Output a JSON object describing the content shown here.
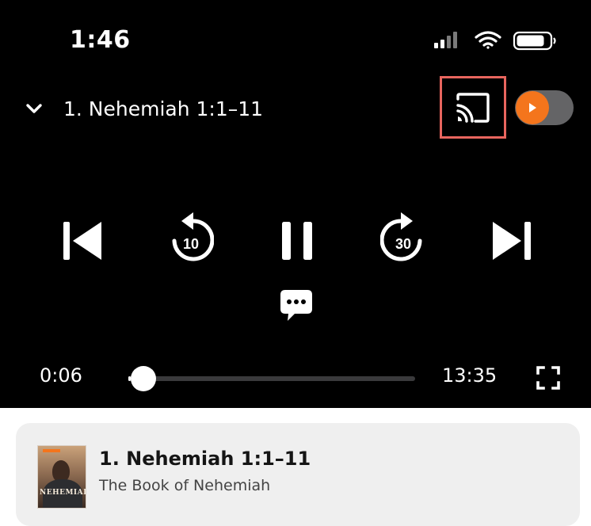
{
  "status_bar": {
    "time": "1:46",
    "signal_icon": "cellular-signal-icon",
    "wifi_icon": "wifi-icon",
    "battery_icon": "battery-icon"
  },
  "header": {
    "collapse_icon": "chevron-down-icon",
    "title": "1. Nehemiah 1:1–11",
    "cast_icon": "cast-icon",
    "autoplay_toggle_on": false
  },
  "controls": {
    "previous_icon": "skip-previous-icon",
    "rewind_seconds": "10",
    "pause_icon": "pause-icon",
    "forward_seconds": "30",
    "next_icon": "skip-next-icon",
    "transcript_icon": "chat-bubble-icon"
  },
  "progress": {
    "elapsed": "0:06",
    "duration": "13:35",
    "fraction": 0.0074,
    "fullscreen_icon": "fullscreen-icon"
  },
  "episode_card": {
    "title": "1. Nehemiah 1:1–11",
    "subtitle": "The Book of Nehemiah",
    "artwork_text": "NEHEMIAH"
  },
  "colors": {
    "background": "#000000",
    "accent": "#f4751c",
    "highlight": "#e8655e",
    "card": "#efefef"
  }
}
